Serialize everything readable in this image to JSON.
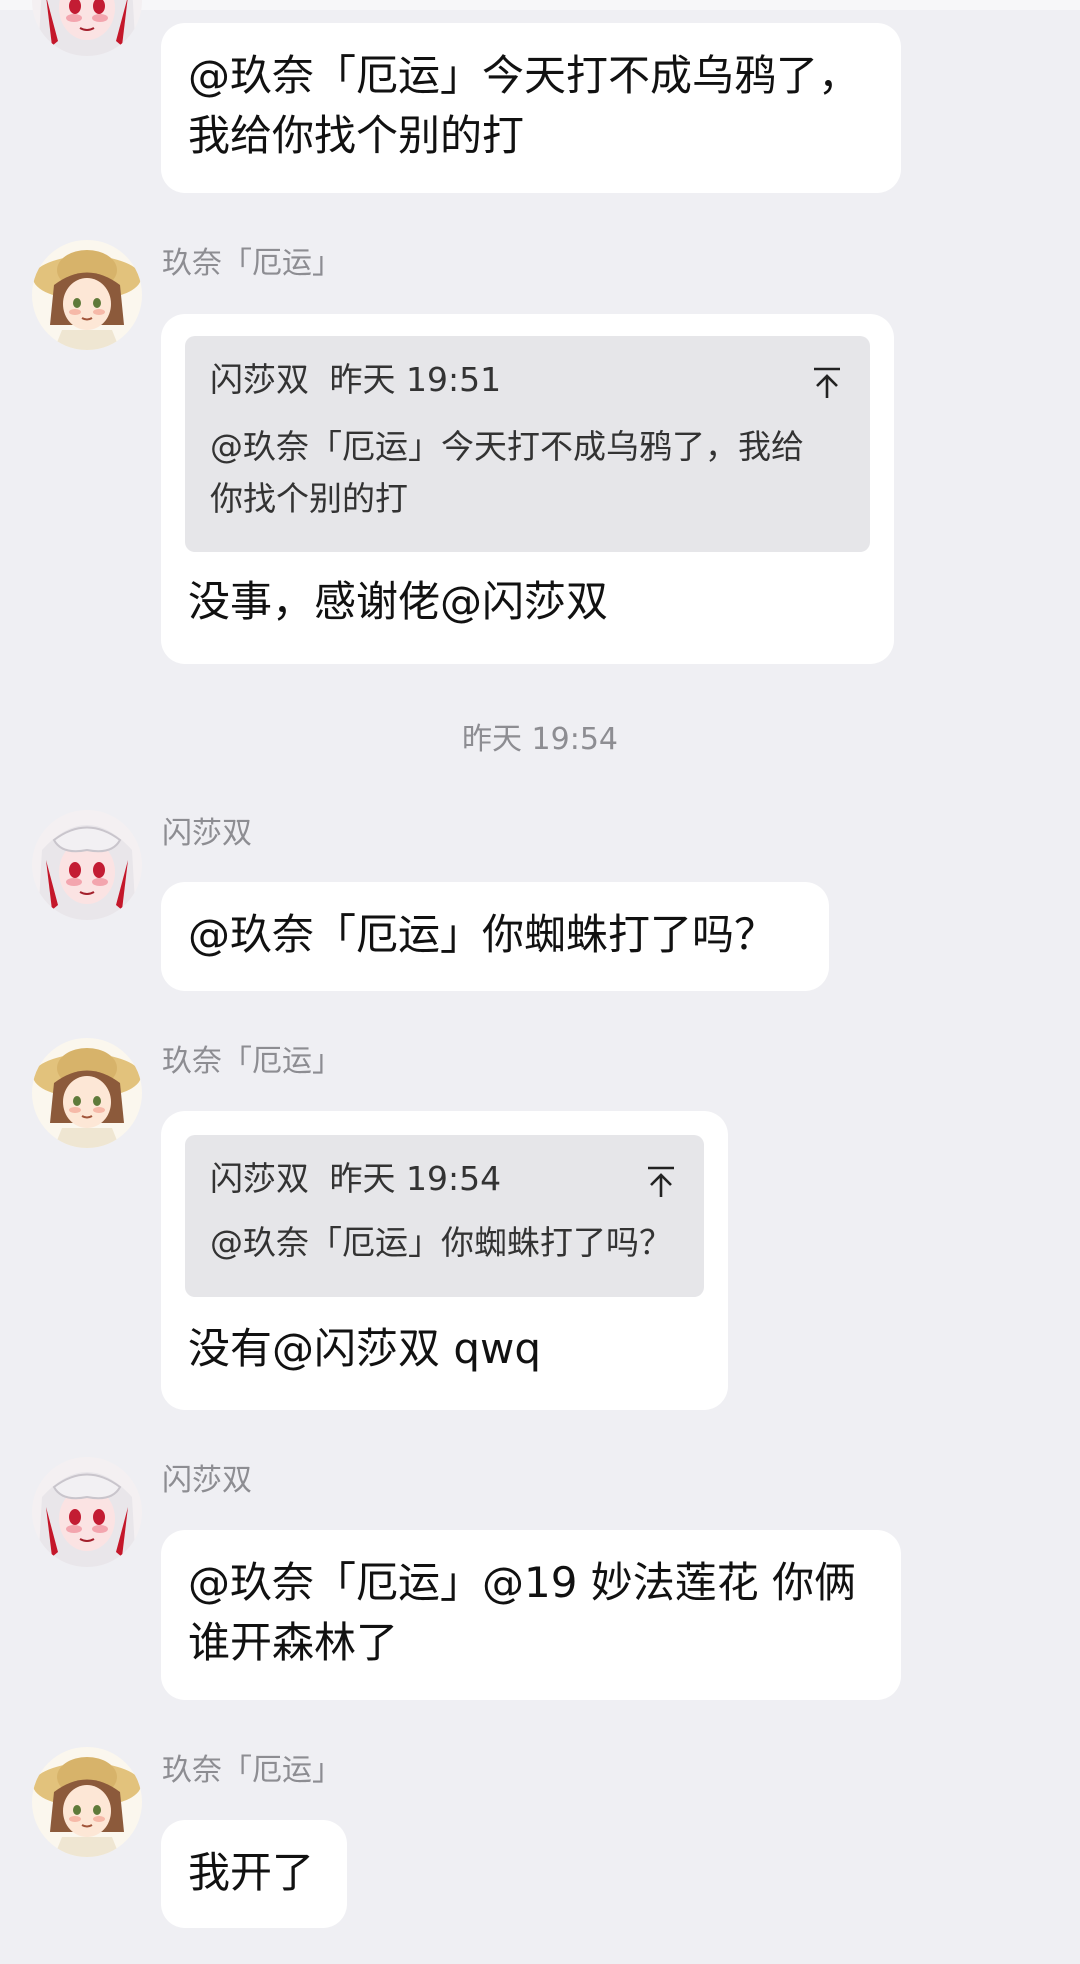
{
  "chat": {
    "time_divider": "昨天 19:54",
    "messages": [
      {
        "sender": "",
        "text": "@玖奈「厄运」今天打不成乌鸦了，我给你找个别的打"
      },
      {
        "sender": "玖奈「厄运」",
        "quote": {
          "author": "闪莎双",
          "time": "昨天 19:51",
          "text": "@玖奈「厄运」今天打不成乌鸦了，我给你找个别的打"
        },
        "text": "没事，感谢佬@闪莎双"
      },
      {
        "sender": "闪莎双",
        "text": "@玖奈「厄运」你蜘蛛打了吗？"
      },
      {
        "sender": "玖奈「厄运」",
        "quote": {
          "author": "闪莎双",
          "time": "昨天 19:54",
          "text": "@玖奈「厄运」你蜘蛛打了吗？"
        },
        "text": "没有@闪莎双 qwq"
      },
      {
        "sender": "闪莎双",
        "text": "@玖奈「厄运」@19  妙法莲花 你俩谁开森林了"
      },
      {
        "sender": "玖奈「厄运」",
        "text": "我开了"
      }
    ]
  },
  "icons": {
    "jump": "arrow-up-to-top-icon",
    "avatar_white_hair": "avatar-white-hair-girl",
    "avatar_straw_hat": "avatar-straw-hat-girl"
  },
  "colors": {
    "background": "#efeff3",
    "bubble": "#ffffff",
    "quote_bg": "#e6e6e9",
    "muted_text": "#8d8d92"
  }
}
